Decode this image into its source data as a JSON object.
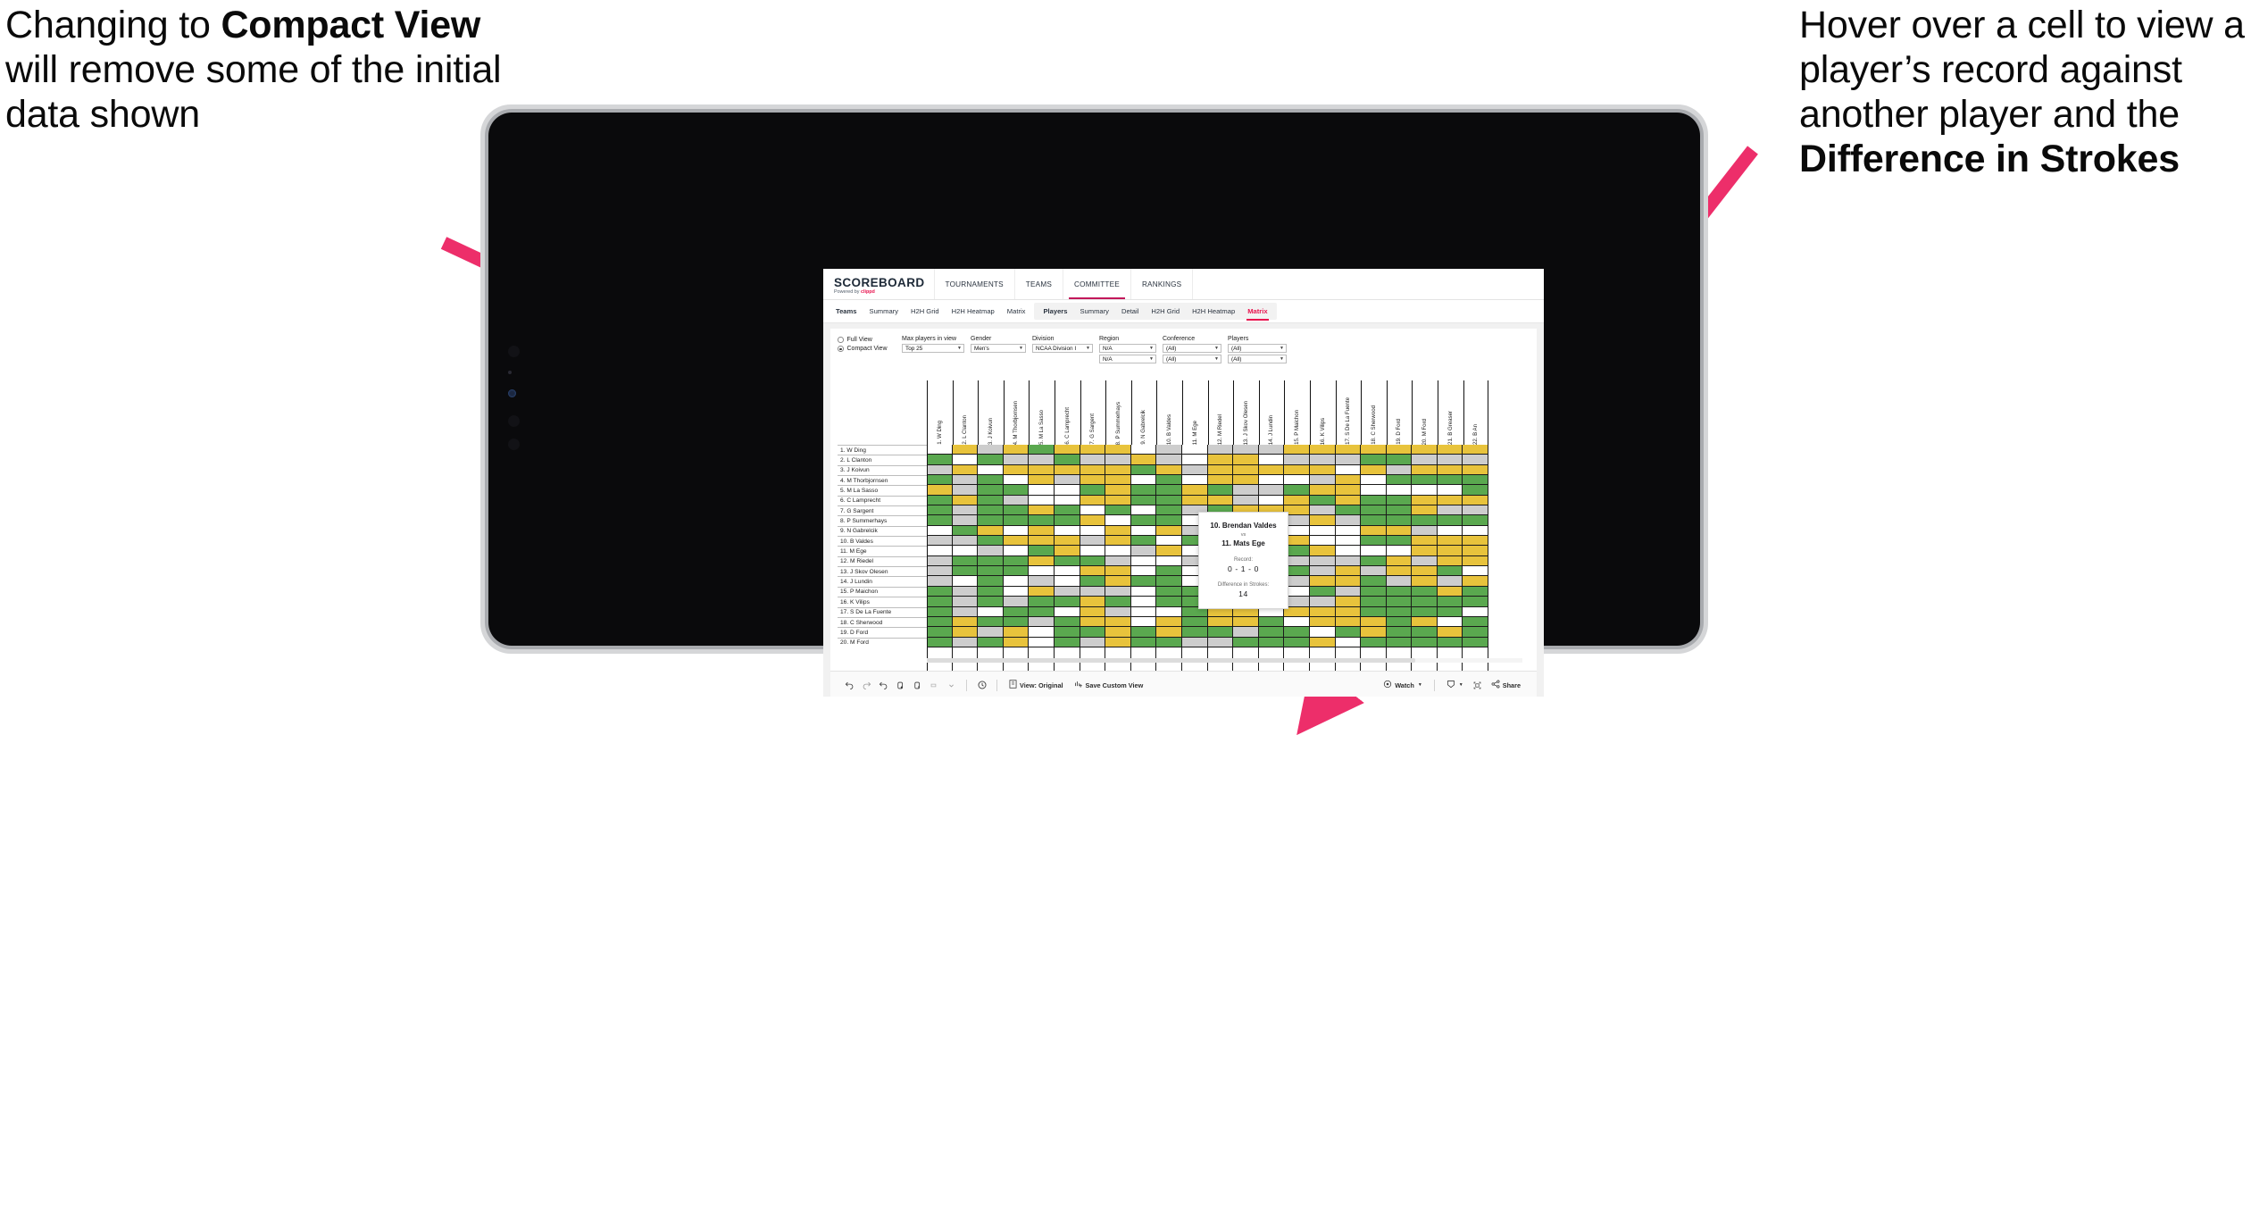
{
  "annotations": {
    "left": {
      "parts": [
        {
          "t": "Changing to ",
          "b": false
        },
        {
          "t": "Compact View",
          "b": true
        },
        {
          "t": " will remove some of the initial data shown",
          "b": false
        }
      ]
    },
    "right": {
      "parts": [
        {
          "t": "Hover over a cell to view a player’s record against another player and the ",
          "b": false
        },
        {
          "t": "Difference in Strokes",
          "b": true
        }
      ]
    },
    "arrow_color": "#ED2E6A"
  },
  "app": {
    "brand": {
      "name": "SCOREBOARD",
      "powered_prefix": "Powered by ",
      "powered_brand": "clippd"
    },
    "nav": [
      {
        "label": "TOURNAMENTS",
        "active": false
      },
      {
        "label": "TEAMS",
        "active": false
      },
      {
        "label": "COMMITTEE",
        "active": true
      },
      {
        "label": "RANKINGS",
        "active": false
      }
    ],
    "subtabs_teams": [
      {
        "label": "Teams",
        "head": true,
        "selected": false
      },
      {
        "label": "Summary",
        "head": false,
        "selected": false
      },
      {
        "label": "H2H Grid",
        "head": false,
        "selected": false
      },
      {
        "label": "H2H Heatmap",
        "head": false,
        "selected": false
      },
      {
        "label": "Matrix",
        "head": false,
        "selected": false
      }
    ],
    "subtabs_players": [
      {
        "label": "Players",
        "head": true,
        "selected": false
      },
      {
        "label": "Summary",
        "head": false,
        "selected": false
      },
      {
        "label": "Detail",
        "head": false,
        "selected": false
      },
      {
        "label": "H2H Grid",
        "head": false,
        "selected": false
      },
      {
        "label": "H2H Heatmap",
        "head": false,
        "selected": false
      },
      {
        "label": "Matrix",
        "head": false,
        "selected": true
      }
    ],
    "accent": "#E8134E"
  },
  "filters": {
    "view_mode": {
      "options": [
        {
          "label": "Full View",
          "selected": false
        },
        {
          "label": "Compact View",
          "selected": true
        }
      ]
    },
    "selects": [
      {
        "label": "Max players in view",
        "value": "Top 25",
        "width": "w70"
      },
      {
        "label": "Gender",
        "value": "Men's",
        "width": "w62"
      },
      {
        "label": "Division",
        "value": "NCAA Division I",
        "width": "w68"
      },
      {
        "label": "Region",
        "value": "N/A",
        "value2": "N/A",
        "width": "w64"
      },
      {
        "label": "Conference",
        "value": "(All)",
        "value2": "(All)",
        "width": "w66"
      },
      {
        "label": "Players",
        "value": "(All)",
        "value2": "(All)",
        "width": "w66"
      }
    ]
  },
  "matrix": {
    "column_headers": [
      "1. W Ding",
      "2. L Clanton",
      "3. J Koivun",
      "4. M Thorbjornsen",
      "5. M La Sasso",
      "6. C Lamprecht",
      "7. G Sargent",
      "8. P Summerhays",
      "9. N Gabrelcik",
      "10. B Valdes",
      "11. M Ege",
      "12. M Riedel",
      "13. J Skov Olesen",
      "14. J Lundin",
      "15. P Maichon",
      "16. K Vilips",
      "17. S De La Fuente",
      "18. C Sherwood",
      "19. D Ford",
      "20. M Ford",
      "21. B Greaser",
      "22. B An"
    ],
    "row_labels": [
      "1. W Ding",
      "2. L Clanton",
      "3. J Koivun",
      "4. M Thorbjornsen",
      "5. M La Sasso",
      "6. C Lamprecht",
      "7. G Sargent",
      "8. P Summerhays",
      "9. N Gabrelcik",
      "10. B Valdes",
      "11. M Ege",
      "12. M Riedel",
      "13. J Skov Olesen",
      "14. J Lundin",
      "15. P Maichon",
      "16. K Vilips",
      "17. S De La Fuente",
      "18. C Sherwood",
      "19. D Ford",
      "20. M Ford"
    ],
    "legend_colors": {
      "win": "#5AA84F",
      "loss": "#E8C33C",
      "tie": "#CDCDCD",
      "none": "#FFFFFF"
    },
    "cells": [
      [
        "w",
        "y",
        "s",
        "y",
        "g",
        "y",
        "y",
        "y",
        "w",
        "s",
        "w",
        "s",
        "s",
        "s",
        "y",
        "y",
        "y",
        "y",
        "y",
        "y",
        "y",
        "y"
      ],
      [
        "g",
        "w",
        "g",
        "s",
        "s",
        "g",
        "s",
        "s",
        "y",
        "s",
        "w",
        "y",
        "y",
        "w",
        "s",
        "s",
        "s",
        "g",
        "g",
        "s",
        "s",
        "s"
      ],
      [
        "s",
        "y",
        "w",
        "y",
        "y",
        "y",
        "y",
        "y",
        "g",
        "y",
        "s",
        "y",
        "y",
        "y",
        "y",
        "y",
        "w",
        "y",
        "s",
        "y",
        "y",
        "y"
      ],
      [
        "g",
        "s",
        "g",
        "w",
        "y",
        "s",
        "y",
        "y",
        "w",
        "g",
        "w",
        "y",
        "y",
        "w",
        "w",
        "s",
        "y",
        "w",
        "g",
        "g",
        "g",
        "g"
      ],
      [
        "y",
        "s",
        "g",
        "g",
        "w",
        "w",
        "g",
        "y",
        "g",
        "g",
        "y",
        "g",
        "s",
        "s",
        "g",
        "y",
        "y",
        "w",
        "w",
        "w",
        "w",
        "g"
      ],
      [
        "g",
        "y",
        "g",
        "s",
        "w",
        "w",
        "y",
        "y",
        "g",
        "g",
        "y",
        "y",
        "s",
        "w",
        "y",
        "g",
        "y",
        "g",
        "g",
        "y",
        "y",
        "y"
      ],
      [
        "g",
        "s",
        "g",
        "g",
        "y",
        "g",
        "w",
        "g",
        "w",
        "g",
        "s",
        "g",
        "y",
        "y",
        "y",
        "s",
        "g",
        "g",
        "g",
        "y",
        "s",
        "s"
      ],
      [
        "g",
        "s",
        "g",
        "g",
        "g",
        "g",
        "y",
        "w",
        "g",
        "g",
        "w",
        "s",
        "s",
        "g",
        "s",
        "y",
        "s",
        "g",
        "g",
        "g",
        "g",
        "g"
      ],
      [
        "w",
        "g",
        "y",
        "w",
        "y",
        "w",
        "w",
        "y",
        "w",
        "y",
        "s",
        "w",
        "g",
        "y",
        "w",
        "w",
        "w",
        "y",
        "y",
        "s",
        "w",
        "w"
      ],
      [
        "s",
        "s",
        "g",
        "y",
        "y",
        "y",
        "s",
        "y",
        "g",
        "w",
        "g",
        "s",
        "y",
        "y",
        "y",
        "w",
        "w",
        "g",
        "g",
        "y",
        "y",
        "y"
      ],
      [
        "w",
        "w",
        "s",
        "w",
        "g",
        "y",
        "w",
        "w",
        "s",
        "y",
        "w",
        "w",
        "w",
        "w",
        "g",
        "y",
        "w",
        "w",
        "w",
        "y",
        "y",
        "y"
      ],
      [
        "s",
        "g",
        "g",
        "g",
        "y",
        "g",
        "g",
        "s",
        "w",
        "w",
        "s",
        "w",
        "g",
        "g",
        "s",
        "s",
        "s",
        "g",
        "y",
        "s",
        "y",
        "y"
      ],
      [
        "s",
        "g",
        "g",
        "g",
        "w",
        "w",
        "y",
        "y",
        "w",
        "g",
        "w",
        "y",
        "w",
        "y",
        "g",
        "s",
        "y",
        "s",
        "y",
        "y",
        "g",
        "w"
      ],
      [
        "s",
        "w",
        "g",
        "w",
        "s",
        "w",
        "g",
        "y",
        "g",
        "g",
        "w",
        "s",
        "s",
        "w",
        "s",
        "y",
        "y",
        "g",
        "s",
        "y",
        "s",
        "y"
      ],
      [
        "g",
        "s",
        "g",
        "w",
        "y",
        "s",
        "s",
        "s",
        "w",
        "g",
        "g",
        "g",
        "s",
        "g",
        "w",
        "g",
        "s",
        "g",
        "g",
        "g",
        "y",
        "g"
      ],
      [
        "g",
        "s",
        "g",
        "s",
        "g",
        "g",
        "y",
        "g",
        "w",
        "g",
        "g",
        "w",
        "g",
        "g",
        "s",
        "s",
        "y",
        "g",
        "g",
        "g",
        "g",
        "g"
      ],
      [
        "g",
        "s",
        "w",
        "g",
        "g",
        "w",
        "y",
        "s",
        "w",
        "w",
        "g",
        "y",
        "y",
        "w",
        "y",
        "y",
        "y",
        "g",
        "g",
        "g",
        "g",
        "w"
      ],
      [
        "g",
        "y",
        "g",
        "g",
        "s",
        "g",
        "y",
        "y",
        "w",
        "y",
        "g",
        "y",
        "y",
        "g",
        "w",
        "y",
        "y",
        "y",
        "g",
        "y",
        "w",
        "g"
      ],
      [
        "g",
        "y",
        "s",
        "y",
        "w",
        "g",
        "g",
        "y",
        "g",
        "y",
        "g",
        "g",
        "s",
        "g",
        "g",
        "w",
        "g",
        "y",
        "g",
        "g",
        "y",
        "g"
      ],
      [
        "g",
        "s",
        "g",
        "y",
        "w",
        "g",
        "s",
        "y",
        "g",
        "g",
        "s",
        "s",
        "g",
        "g",
        "g",
        "y",
        "w",
        "g",
        "g",
        "g",
        "g",
        "g"
      ]
    ]
  },
  "tooltip": {
    "player_a": "10. Brendan Valdes",
    "vs": "vs",
    "player_b": "11. Mats Ege",
    "record_label": "Record:",
    "record_value": "0 - 1 - 0",
    "diff_label": "Difference in Strokes:",
    "diff_value": "14"
  },
  "toolbar": {
    "icons": [
      {
        "name": "undo-icon"
      },
      {
        "name": "redo-icon"
      },
      {
        "name": "revert-icon"
      },
      {
        "name": "refresh-icon"
      },
      {
        "name": "pause-icon"
      },
      {
        "name": "highlight-icon"
      }
    ],
    "clock_icon": "clock-icon",
    "view_label": "View: Original",
    "save_label": "Save Custom View",
    "watch_label": "Watch",
    "share_label": "Share"
  }
}
